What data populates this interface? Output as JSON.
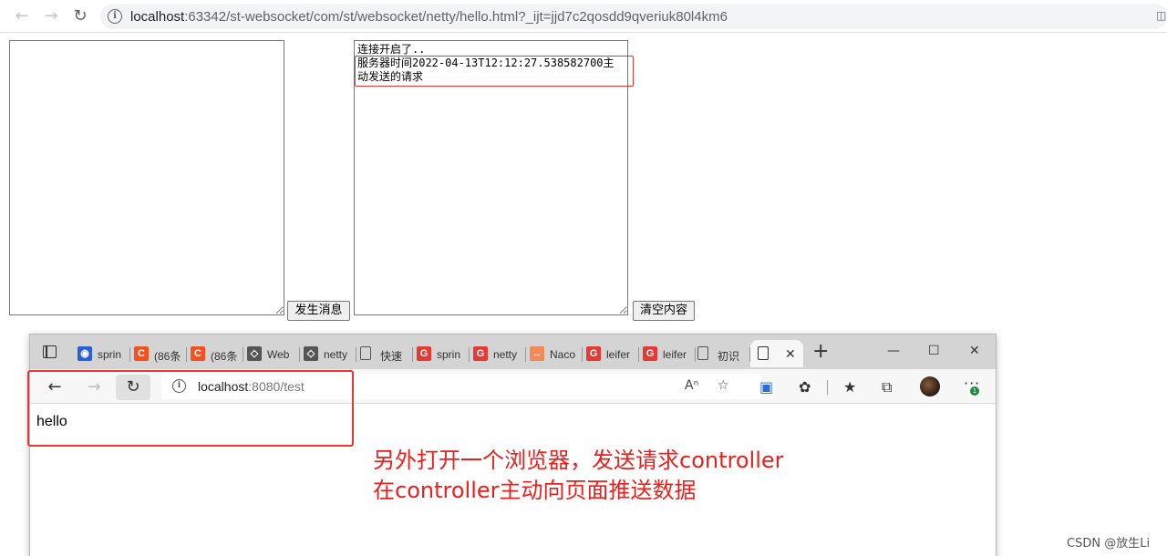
{
  "top_browser": {
    "url_host": "localhost",
    "url_path": ":63342/st-websocket/com/st/websocket/netty/hello.html?_ijt=jjd7c2qosdd9qveriuk80l4km6"
  },
  "page": {
    "message_input_value": "",
    "send_button_label": "发生消息",
    "log_area_value": "连接开启了..\n服务器时间2022-04-13T12:12:27.538582700主动发送的请求",
    "clear_button_label": "清空内容"
  },
  "edge_browser": {
    "tabs": [
      {
        "label": "sprin",
        "favicon": "baidu-paw-icon",
        "color": "#2a5fd8"
      },
      {
        "label": "(86条",
        "favicon": "csdn-c-icon",
        "color": "#f4511e"
      },
      {
        "label": "(86条",
        "favicon": "csdn-c-icon",
        "color": "#f4511e"
      },
      {
        "label": "Web",
        "favicon": "yuque-icon",
        "color": "#555555"
      },
      {
        "label": "netty",
        "favicon": "yuque-icon",
        "color": "#555555"
      },
      {
        "label": "快速",
        "favicon": "document-icon",
        "color": "#555555"
      },
      {
        "label": "sprin",
        "favicon": "gitee-icon",
        "color": "#e53935"
      },
      {
        "label": "netty",
        "favicon": "gitee-icon",
        "color": "#e53935"
      },
      {
        "label": "Naco",
        "favicon": "nacos-icon",
        "color": "#f08a5d"
      },
      {
        "label": "leifer",
        "favicon": "gitee-icon",
        "color": "#e53935"
      },
      {
        "label": "leifer",
        "favicon": "gitee-icon",
        "color": "#e53935"
      },
      {
        "label": "初识",
        "favicon": "document-icon",
        "color": "#555555"
      }
    ],
    "url_host": "localhost",
    "url_path": ":8080/test",
    "page_text": "hello"
  },
  "annotation": {
    "line1": "另外打开一个浏览器，发送请求controller",
    "line2": "在controller主动向页面推送数据"
  },
  "watermark": "CSDN @放生Li",
  "colors": {
    "annotation_red": "#e8201e",
    "highlight_red": "#e53935"
  }
}
